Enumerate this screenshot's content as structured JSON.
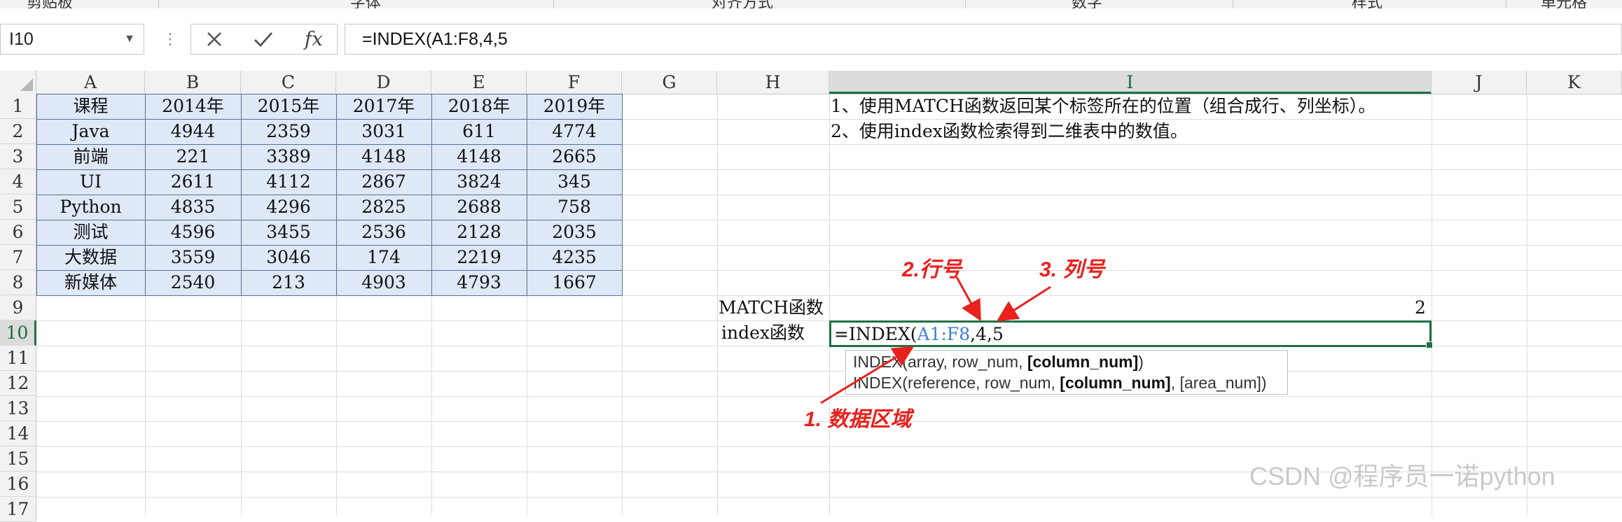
{
  "ribbon": {
    "groups": [
      "剪贴板",
      "字体",
      "对齐方式",
      "数字",
      "样式",
      "单元格"
    ]
  },
  "formula_bar": {
    "name_box": "I10",
    "cancel_icon": "close-icon",
    "enter_icon": "check-icon",
    "fx_label": "fx",
    "formula": "=INDEX(A1:F8,4,5"
  },
  "columns": [
    "A",
    "B",
    "C",
    "D",
    "E",
    "F",
    "G",
    "H",
    "I",
    "J",
    "K"
  ],
  "rows": [
    "1",
    "2",
    "3",
    "4",
    "5",
    "6",
    "7",
    "8",
    "9",
    "10",
    "11",
    "12",
    "13",
    "14",
    "15",
    "16",
    "17"
  ],
  "table": {
    "header": [
      "课程",
      "2014年",
      "2015年",
      "2017年",
      "2018年",
      "2019年"
    ],
    "rows": [
      [
        "Java",
        "4944",
        "2359",
        "3031",
        "611",
        "4774"
      ],
      [
        "前端",
        "221",
        "3389",
        "4148",
        "4148",
        "2665"
      ],
      [
        "UI",
        "2611",
        "4112",
        "2867",
        "3824",
        "345"
      ],
      [
        "Python",
        "4835",
        "4296",
        "2825",
        "2688",
        "758"
      ],
      [
        "测试",
        "4596",
        "3455",
        "2536",
        "2128",
        "2035"
      ],
      [
        "大数据",
        "3559",
        "3046",
        "174",
        "2219",
        "4235"
      ],
      [
        "新媒体",
        "2540",
        "213",
        "4903",
        "4793",
        "1667"
      ]
    ]
  },
  "notes": [
    "1、使用MATCH函数返回某个标签所在的位置（组合成行、列坐标）。",
    "2、使用index函数检索得到二维表中的数值。"
  ],
  "labels": {
    "match": "MATCH函数",
    "index": "index函数",
    "match_result": "2"
  },
  "active_cell": {
    "prefix": "=INDEX(",
    "range": "A1:F8",
    "suffix": ",4,5"
  },
  "tooltip": {
    "line1": {
      "fn": "INDEX(array, row_num, ",
      "bold": "[column_num]",
      "tail": ")"
    },
    "line2": {
      "fn": "INDEX(reference, row_num, ",
      "bold": "[column_num]",
      "tail": ", [area_num])"
    }
  },
  "annotations": {
    "row_num": "2.行号",
    "col_num": "3. 列号",
    "data_area": "1. 数据区域",
    "color": "#e8211d"
  },
  "watermark": "CSDN @程序员一诺python"
}
